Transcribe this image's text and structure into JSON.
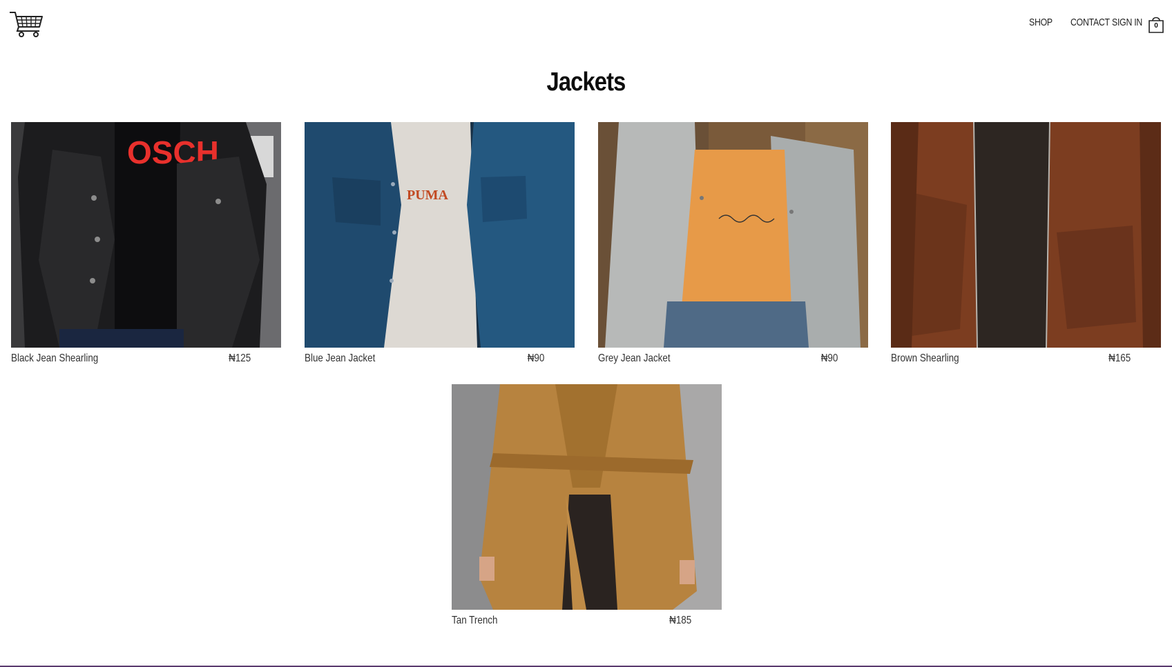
{
  "header": {
    "logo_icon": "shopping-cart-icon",
    "nav": {
      "shop": "SHOP",
      "contact": "CONTACT",
      "sign_in": "SIGN IN"
    },
    "bag_icon": "shopping-bag-icon",
    "bag_count": "0"
  },
  "page": {
    "title": "Jackets"
  },
  "products": [
    {
      "name": "Black Jean Shearling",
      "price": "₦125",
      "icon": "product-image"
    },
    {
      "name": "Blue Jean Jacket",
      "price": "₦90",
      "icon": "product-image"
    },
    {
      "name": "Grey Jean Jacket",
      "price": "₦90",
      "icon": "product-image"
    },
    {
      "name": "Brown Shearling",
      "price": "₦165",
      "icon": "product-image"
    },
    {
      "name": "Tan Trench",
      "price": "₦185",
      "icon": "product-image"
    }
  ],
  "image_text": {
    "p1_shirt": "OSCH",
    "p2_shirt": "PUMA"
  },
  "colors": {
    "accent_bottom": "#5a3a6e"
  }
}
